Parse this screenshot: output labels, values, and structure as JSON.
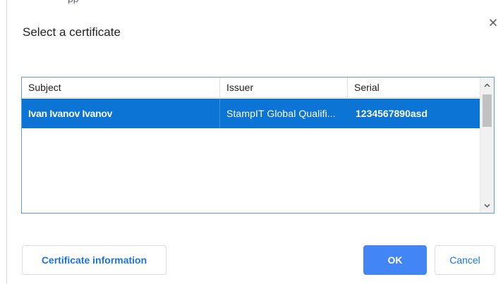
{
  "dialog": {
    "title": "Select a certificate",
    "top_clipped_text": "pp"
  },
  "table": {
    "columns": [
      "Subject",
      "Issuer",
      "Serial"
    ],
    "rows": [
      {
        "subject": "Ivan Ivanov Ivanov",
        "issuer": "StampIT Global Qualifi...",
        "serial": "1234567890asd",
        "selected": true
      }
    ]
  },
  "buttons": {
    "certificate_info": "Certificate information",
    "ok": "OK",
    "cancel": "Cancel"
  },
  "icons": {
    "close": "close-icon",
    "scroll_up": "chevron-up-icon",
    "scroll_down": "chevron-down-icon"
  },
  "colors": {
    "selection": "#0b74d4",
    "accent": "#1a73e8",
    "ok_button": "#4285f4",
    "list_border": "#5f9fd6"
  }
}
